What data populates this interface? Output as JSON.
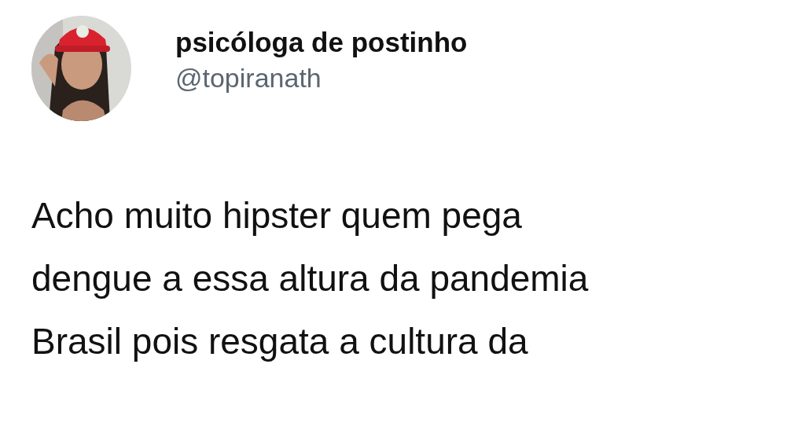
{
  "author": {
    "name": "psicóloga de postinho",
    "handle": "@topiranath"
  },
  "tweet": {
    "lines": [
      "Acho muito hipster quem pega",
      "dengue a essa altura da pandemia",
      "Brasil pois resgata a cultura da"
    ]
  }
}
